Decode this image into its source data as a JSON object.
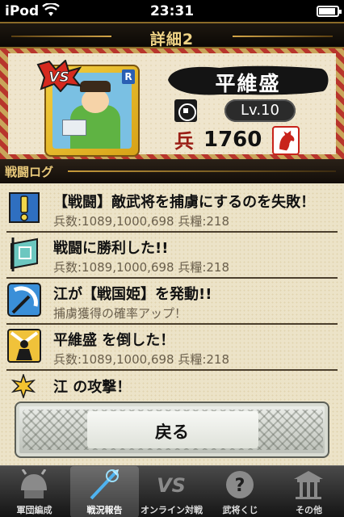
{
  "status_bar": {
    "carrier": "iPod",
    "time": "23:31",
    "battery_level": 0.84
  },
  "header": {
    "title": "詳細2"
  },
  "general": {
    "vs_badge": "VS",
    "card_rank": "R",
    "name": "平維盛",
    "level": "Lv.10",
    "troops_icon": "兵",
    "troops": "1760"
  },
  "section": {
    "title": "戦闘ログ"
  },
  "log": [
    {
      "icon": "exclamation-icon",
      "title": "【戦闘】敵武将を捕虜にするのを失敗！",
      "detail": "兵数:1089,1000,698 兵糧:218"
    },
    {
      "icon": "victory-banner-icon",
      "title": "戦闘に勝利した!!",
      "detail": "兵数:1089,1000,698 兵糧:218"
    },
    {
      "icon": "sickle-skill-icon",
      "title": "江が【戦国姫】を発動!!",
      "detail": "捕虜獲得の確率アップ！"
    },
    {
      "icon": "defeated-general-icon",
      "title": "平維盛 を倒した！",
      "detail": "兵数:1089,1000,698 兵糧:218"
    },
    {
      "icon": "attack-burst-icon",
      "title": "江 の攻撃！",
      "detail": ""
    }
  ],
  "back_button": {
    "label": "戻る"
  },
  "tabs": [
    {
      "icon": "helmet-icon",
      "label": "軍団編成",
      "selected": false
    },
    {
      "icon": "spear-icon",
      "label": "戦況報告",
      "selected": true
    },
    {
      "icon": "vs-icon",
      "label": "オンライン対戦",
      "selected": false
    },
    {
      "icon": "question-icon",
      "label": "武将くじ",
      "selected": false
    },
    {
      "icon": "shrine-icon",
      "label": "その他",
      "selected": false
    }
  ],
  "colors": {
    "title_gold": "#f0d486",
    "border_red": "#b8352c",
    "parchment": "#ece3c8",
    "tabbar_dark": "#151515"
  }
}
